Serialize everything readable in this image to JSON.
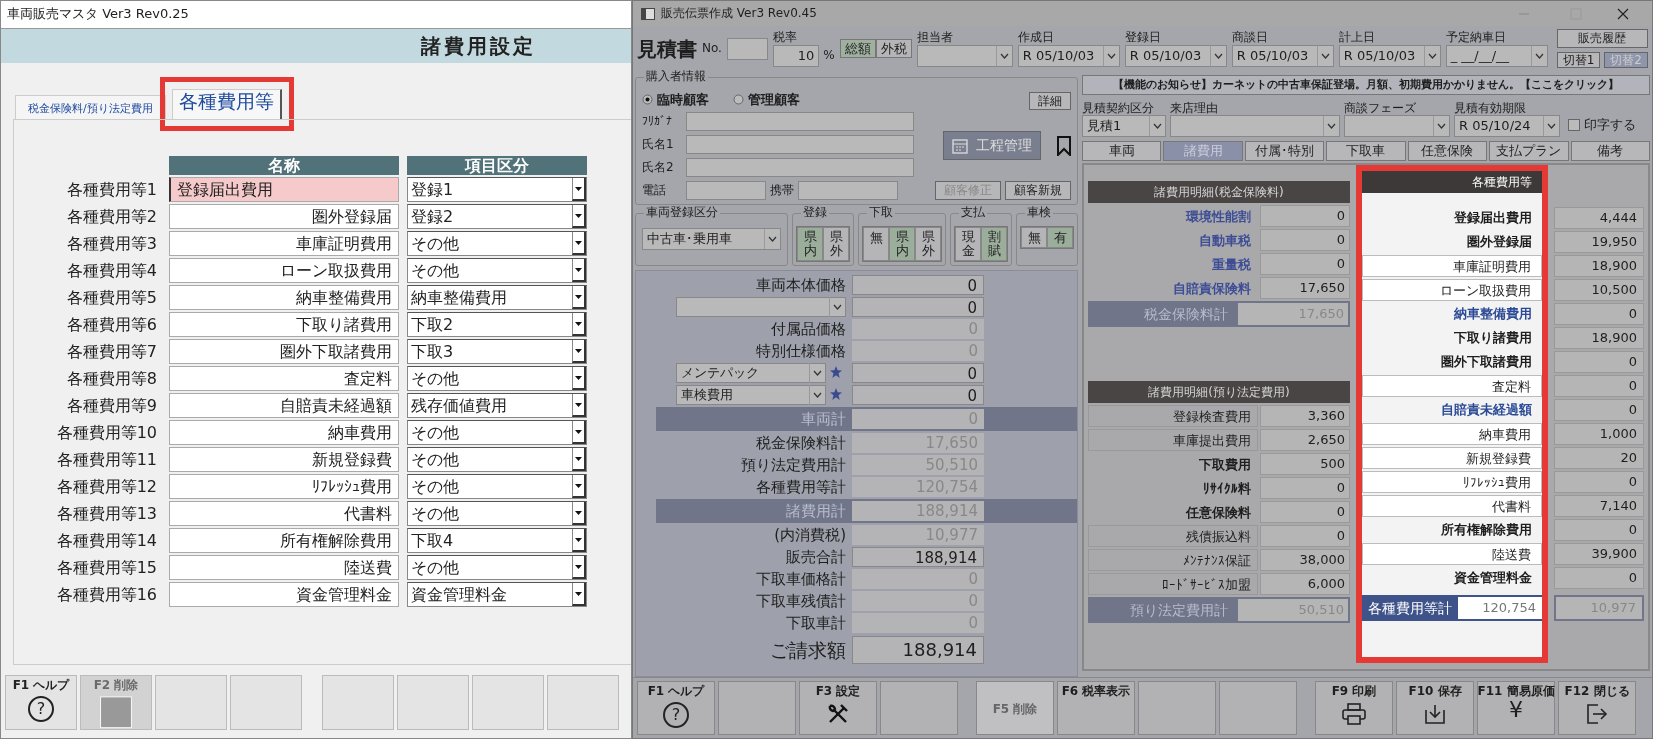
{
  "left_window": {
    "title": "車両販売マスタ Ver3 Rev0.25",
    "header": "諸費用設定",
    "tabs": [
      {
        "label": "税金保険料/預り法定費用",
        "selected": false,
        "highlighted": false
      },
      {
        "label": "各種費用等",
        "selected": true,
        "highlighted": true
      }
    ],
    "columns": [
      "名称",
      "項目区分"
    ],
    "rows": [
      {
        "label": "各種費用等1",
        "name": "登録届出費用",
        "category": "登録1",
        "focused": true
      },
      {
        "label": "各種費用等2",
        "name": "圏外登録届",
        "category": "登録2",
        "focused": false
      },
      {
        "label": "各種費用等3",
        "name": "車庫証明費用",
        "category": "その他",
        "focused": false
      },
      {
        "label": "各種費用等4",
        "name": "ローン取扱費用",
        "category": "その他",
        "focused": false
      },
      {
        "label": "各種費用等5",
        "name": "納車整備費用",
        "category": "納車整備費用",
        "focused": false
      },
      {
        "label": "各種費用等6",
        "name": "下取り諸費用",
        "category": "下取2",
        "focused": false
      },
      {
        "label": "各種費用等7",
        "name": "圏外下取諸費用",
        "category": "下取3",
        "focused": false
      },
      {
        "label": "各種費用等8",
        "name": "査定料",
        "category": "その他",
        "focused": false
      },
      {
        "label": "各種費用等9",
        "name": "自賠責未経過額",
        "category": "残存価値費用",
        "focused": false
      },
      {
        "label": "各種費用等10",
        "name": "納車費用",
        "category": "その他",
        "focused": false
      },
      {
        "label": "各種費用等11",
        "name": "新規登録費",
        "category": "その他",
        "focused": false
      },
      {
        "label": "各種費用等12",
        "name": "ﾘﾌﾚｯｼｭ費用",
        "category": "その他",
        "focused": false
      },
      {
        "label": "各種費用等13",
        "name": "代書料",
        "category": "その他",
        "focused": false
      },
      {
        "label": "各種費用等14",
        "name": "所有権解除費用",
        "category": "下取4",
        "focused": false
      },
      {
        "label": "各種費用等15",
        "name": "陸送費",
        "category": "その他",
        "focused": false
      },
      {
        "label": "各種費用等16",
        "name": "資金管理料金",
        "category": "資金管理料金",
        "focused": false
      }
    ],
    "function_key_groups": [
      [
        {
          "kind": "help",
          "label": "F1 ヘルプ",
          "glyph": "?",
          "disabled": false
        },
        {
          "kind": "delete",
          "label": "F2 削除",
          "disabled": true
        },
        {
          "kind": "empty"
        },
        {
          "kind": "empty"
        }
      ],
      [
        {
          "kind": "empty"
        },
        {
          "kind": "empty"
        },
        {
          "kind": "empty"
        },
        {
          "kind": "empty"
        }
      ]
    ]
  },
  "right_window": {
    "title": "販売伝票作成 Ver3 Rev0.45",
    "document_type": "見積書",
    "no_label": "No.",
    "tax_rate": {
      "label": "税率",
      "value": "10",
      "unit": "%"
    },
    "tax_modes": [
      {
        "label": "総額",
        "selected": true
      },
      {
        "label": "外税",
        "selected": false
      }
    ],
    "header_fields": [
      {
        "label": "担当者"
      },
      {
        "label": "作成日",
        "value": "R 05/10/03"
      },
      {
        "label": "登録日",
        "value": "R 05/10/03"
      },
      {
        "label": "商談日",
        "value": "R 05/10/03"
      },
      {
        "label": "計上日",
        "value": "R 05/10/03"
      },
      {
        "label": "予定納車日",
        "value": "_ __/__/__"
      }
    ],
    "history_button": "販売履歴",
    "switch_buttons": [
      {
        "label": "切替1",
        "selected": false
      },
      {
        "label": "切替2",
        "selected": true
      }
    ],
    "buyer": {
      "title": "購入者情報",
      "detail_button": "詳細",
      "customer_types": [
        {
          "label": "臨時顧客",
          "selected": true
        },
        {
          "label": "管理顧客",
          "selected": false
        }
      ],
      "fields": [
        {
          "label": "ﾌﾘｶﾞﾅ"
        },
        {
          "label": "氏名1"
        },
        {
          "label": "氏名2"
        }
      ],
      "phone_label": "電話",
      "mobile_label": "携帯",
      "process_button": "工程管理",
      "buttons": [
        {
          "label": "顧客修正",
          "disabled": true
        },
        {
          "label": "顧客新規",
          "disabled": false
        }
      ]
    },
    "registration": {
      "title": "車両登録区分",
      "value": "中古車･乗用車",
      "toggle_groups": [
        {
          "title": "登録",
          "options": [
            {
              "label": "県内",
              "selected": true
            },
            {
              "label": "県外",
              "selected": false
            }
          ]
        },
        {
          "title": "下取",
          "options": [
            {
              "label": "無",
              "selected": false
            },
            {
              "label": "県内",
              "selected": true
            },
            {
              "label": "県外",
              "selected": false
            }
          ]
        },
        {
          "title": "支払",
          "options": [
            {
              "label": "現金",
              "selected": false
            },
            {
              "label": "割賦",
              "selected": true
            }
          ]
        },
        {
          "title": "車検",
          "options": [
            {
              "label": "無",
              "selected": false
            },
            {
              "label": "有",
              "selected": true
            }
          ]
        }
      ]
    },
    "price_rows": [
      {
        "kind": "label",
        "label": "車両本体価格",
        "value": "0",
        "disabled": false
      },
      {
        "kind": "select",
        "value": "0",
        "disabled": false
      },
      {
        "kind": "label",
        "label": "付属品価格",
        "value": "0",
        "disabled": true
      },
      {
        "kind": "label",
        "label": "特別仕様価格",
        "value": "0",
        "disabled": true
      },
      {
        "kind": "star",
        "label": "メンテパック",
        "value": "0",
        "disabled": false
      },
      {
        "kind": "star",
        "label": "車検費用",
        "value": "0",
        "disabled": false
      },
      {
        "kind": "band",
        "label": "車両計",
        "value": "0",
        "disabled": true
      },
      {
        "kind": "label",
        "label": "税金保険料計",
        "value": "17,650",
        "disabled": true
      },
      {
        "kind": "label",
        "label": "預り法定費用計",
        "value": "50,510",
        "disabled": true
      },
      {
        "kind": "label",
        "label": "各種費用等計",
        "value": "120,754",
        "disabled": true
      },
      {
        "kind": "band",
        "label": "諸費用計",
        "value": "188,914",
        "disabled": true
      },
      {
        "kind": "label",
        "label": "(内消費税)",
        "value": "10,977",
        "disabled": true
      },
      {
        "kind": "label",
        "label": "販売合計",
        "value": "188,914",
        "disabled": false
      },
      {
        "kind": "label",
        "label": "下取車価格計",
        "value": "0",
        "disabled": true
      },
      {
        "kind": "label",
        "label": "下取車残債計",
        "value": "0",
        "disabled": true
      },
      {
        "kind": "label",
        "label": "下取車計",
        "value": "0",
        "disabled": true
      },
      {
        "kind": "grand",
        "label": "ご請求額",
        "value": "188,914",
        "disabled": false
      }
    ],
    "notice": "【機能のお知らせ】カーネットの中古車保証登場。月額、初期費用かかりません。【ここをクリック】",
    "estimate_fields": [
      {
        "label": "見積契約区分",
        "value": "見積1"
      },
      {
        "label": "来店理由"
      },
      {
        "label": "商談フェーズ"
      },
      {
        "label": "見積有効期限",
        "value": "R 05/10/24"
      }
    ],
    "print_checkbox": {
      "label": "印字する",
      "checked": false
    },
    "tabs": [
      {
        "label": "車両",
        "selected": false
      },
      {
        "label": "諸費用",
        "selected": true
      },
      {
        "label": "付属･特別",
        "selected": false
      },
      {
        "label": "下取車",
        "selected": false
      },
      {
        "label": "任意保険",
        "selected": false
      },
      {
        "label": "支払プラン",
        "selected": false
      },
      {
        "label": "備考",
        "selected": false
      }
    ],
    "tax_section": {
      "title": "諸費用明細(税金保険料)",
      "rows": [
        {
          "label": "環境性能割",
          "value": "0",
          "emphasis": true
        },
        {
          "label": "自動車税",
          "value": "0",
          "emphasis": true
        },
        {
          "label": "重量税",
          "value": "0",
          "emphasis": true
        },
        {
          "label": "自賠責保険料",
          "value": "17,650",
          "emphasis": true
        }
      ],
      "total_label": "税金保険料計",
      "total": "17,650"
    },
    "legal_section": {
      "title": "諸費用明細(預り法定費用)",
      "rows": [
        {
          "label": "登録検査費用",
          "value": "3,360",
          "emphasis": false
        },
        {
          "label": "車庫提出費用",
          "value": "2,650",
          "emphasis": false
        },
        {
          "label": "下取費用",
          "value": "500",
          "emphasis": true
        },
        {
          "label": "ﾘｻｲｸﾙ料",
          "value": "0",
          "emphasis": true
        },
        {
          "label": "任意保険料",
          "value": "0",
          "emphasis": true
        },
        {
          "label": "残債振込料",
          "value": "0",
          "emphasis": false
        },
        {
          "label": "ﾒﾝﾃﾅﾝｽ保証",
          "value": "38,000",
          "emphasis": false
        },
        {
          "label": "ﾛｰﾄﾞｻｰﾋﾞｽ加盟",
          "value": "6,000",
          "emphasis": false
        }
      ],
      "total_label": "預り法定費用計",
      "total": "50,510"
    },
    "misc_panel": {
      "title": "各種費用等",
      "highlighted": true,
      "items": [
        {
          "kind": "label",
          "label": "登録届出費用"
        },
        {
          "kind": "label",
          "label": "圏外登録届"
        },
        {
          "kind": "field",
          "label": "車庫証明費用"
        },
        {
          "kind": "field",
          "label": "ローン取扱費用"
        },
        {
          "kind": "link",
          "label": "納車整備費用"
        },
        {
          "kind": "label",
          "label": "下取り諸費用"
        },
        {
          "kind": "label",
          "label": "圏外下取諸費用"
        },
        {
          "kind": "field",
          "label": "査定料"
        },
        {
          "kind": "link",
          "label": "自賠責未経過額"
        },
        {
          "kind": "field",
          "label": "納車費用"
        },
        {
          "kind": "field",
          "label": "新規登録費"
        },
        {
          "kind": "field",
          "label": "ﾘﾌﾚｯｼｭ費用"
        },
        {
          "kind": "field",
          "label": "代書料"
        },
        {
          "kind": "label",
          "label": "所有権解除費用"
        },
        {
          "kind": "field",
          "label": "陸送費"
        },
        {
          "kind": "label",
          "label": "資金管理料金"
        }
      ],
      "total_label": "各種費用等計",
      "total": "120,754"
    },
    "misc_values": [
      "4,444",
      "19,950",
      "18,900",
      "10,500",
      "0",
      "18,900",
      "0",
      "0",
      "0",
      "1,000",
      "20",
      "0",
      "7,140",
      "0",
      "39,900",
      "0"
    ],
    "misc_values_total": "10,977",
    "function_key_groups": [
      [
        {
          "kind": "help",
          "label": "F1 ヘルプ",
          "glyph": "?",
          "disabled": false
        },
        {
          "kind": "empty"
        },
        {
          "kind": "settings",
          "label": "F3 設定",
          "disabled": false
        },
        {
          "kind": "empty"
        }
      ],
      [
        {
          "kind": "text",
          "label": "F5 削除",
          "disabled": true
        },
        {
          "kind": "text",
          "label": "F6 税率表示",
          "disabled": false
        },
        {
          "kind": "empty"
        },
        {
          "kind": "empty"
        }
      ],
      [
        {
          "kind": "print",
          "label": "F9 印刷",
          "disabled": false
        },
        {
          "kind": "save",
          "label": "F10 保存",
          "disabled": false
        },
        {
          "kind": "cost",
          "label": "F11 簡易原価",
          "glyph": "¥",
          "disabled": false
        },
        {
          "kind": "close",
          "label": "F12 閉じる",
          "disabled": false
        }
      ]
    ]
  }
}
